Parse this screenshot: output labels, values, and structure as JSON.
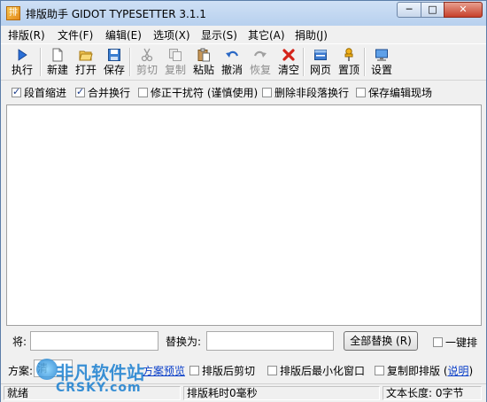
{
  "window": {
    "title": "排版助手 GIDOT TYPESETTER 3.1.1",
    "buttons": {
      "minimize": "─",
      "maximize": "□",
      "close": "✕"
    }
  },
  "menu": [
    "排版(R)",
    "文件(F)",
    "编辑(E)",
    "选项(X)",
    "显示(S)",
    "其它(A)",
    "捐助(J)"
  ],
  "toolbar": [
    {
      "label": "执行",
      "icon": "play-icon",
      "enabled": true
    },
    {
      "label": "新建",
      "icon": "new-document-icon",
      "enabled": true
    },
    {
      "label": "打开",
      "icon": "open-folder-icon",
      "enabled": true
    },
    {
      "label": "保存",
      "icon": "save-disk-icon",
      "enabled": true
    },
    {
      "label": "剪切",
      "icon": "scissors-icon",
      "enabled": false
    },
    {
      "label": "复制",
      "icon": "copy-icon",
      "enabled": false
    },
    {
      "label": "粘贴",
      "icon": "paste-clipboard-icon",
      "enabled": true
    },
    {
      "label": "撤消",
      "icon": "undo-arrow-icon",
      "enabled": true
    },
    {
      "label": "恢复",
      "icon": "redo-arrow-icon",
      "enabled": false
    },
    {
      "label": "清空",
      "icon": "red-x-icon",
      "enabled": true
    },
    {
      "label": "网页",
      "icon": "html-page-icon",
      "enabled": true
    },
    {
      "label": "置顶",
      "icon": "pushpin-icon",
      "enabled": true
    },
    {
      "label": "设置",
      "icon": "settings-monitor-icon",
      "enabled": true
    }
  ],
  "options": [
    {
      "label": "段首缩进",
      "checked": true
    },
    {
      "label": "合并换行",
      "checked": true
    },
    {
      "label": "修正干扰符 (谨慎使用)",
      "checked": false
    },
    {
      "label": "删除非段落换行",
      "checked": false
    },
    {
      "label": "保存编辑现场",
      "checked": false
    }
  ],
  "replace": {
    "find_label": "将:",
    "find_value": "",
    "replace_label": "替换为:",
    "replace_value": "",
    "replace_all_button": "全部替换 (R)",
    "one_click_label": "一键排"
  },
  "scheme": {
    "label": "方案:",
    "value": "清",
    "preview_link": "方案预览",
    "options": [
      {
        "label": "排版后剪切",
        "checked": false
      },
      {
        "label": "排版后最小化窗口",
        "checked": false
      },
      {
        "label": "复制即排版 (",
        "checked": false
      }
    ],
    "help_link": "说明",
    "help_close": ")"
  },
  "status": {
    "left": "就绪",
    "middle": "排版耗时0毫秒",
    "right": "文本长度: 0字节"
  },
  "watermark": {
    "text": "非凡软件站",
    "sub": "CRSKY.com"
  }
}
